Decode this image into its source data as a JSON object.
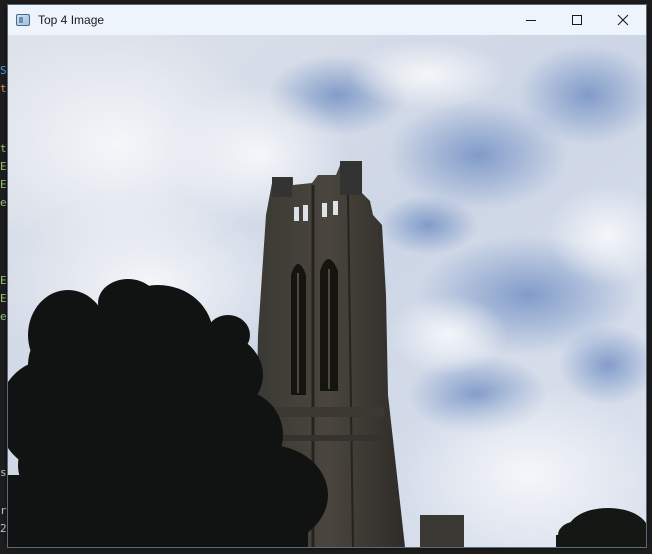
{
  "window": {
    "title": "Top 4 Image",
    "icon": "app-window-icon",
    "controls": {
      "minimize_icon": "minimize-icon",
      "maximize_icon": "maximize-icon",
      "close_icon": "close-icon"
    }
  },
  "background_editor": {
    "visible_chars": [
      "S",
      "t",
      "t",
      "E",
      "E",
      "e",
      "E",
      "E",
      "e",
      "s",
      "r",
      "2"
    ],
    "char_colors": [
      "#4fa3ff",
      "#d19a66",
      "#9cc97a",
      "#9cc97a",
      "#9cc97a",
      "#9cc97a",
      "#9cc97a",
      "#9cc97a",
      "#9cc97a",
      "#cccccc",
      "#cccccc",
      "#cccccc"
    ]
  },
  "image": {
    "description_icon": "photo-icon",
    "sky_color": "#d6dce8",
    "cloud_color": "#eef1f6",
    "blue_patch_color": "#7f98c6",
    "tower_color": "#2f2e2b",
    "tree_color": "#101311"
  }
}
